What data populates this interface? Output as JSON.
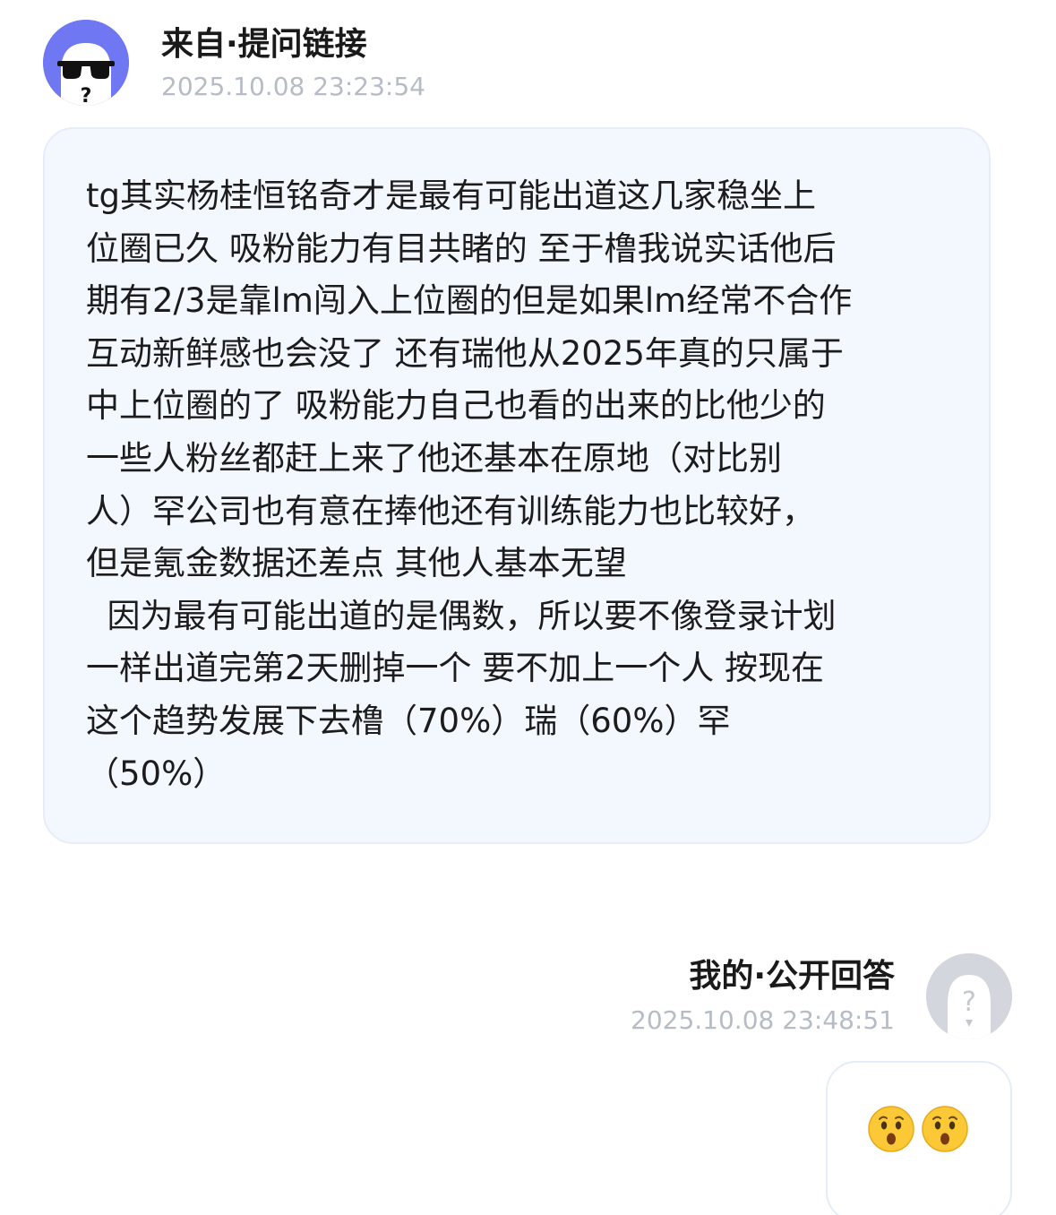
{
  "question": {
    "sender_label": "来自·提问链接",
    "timestamp": "2025.10.08 23:23:54",
    "avatar": "sunglasses-ghost-avatar",
    "lines": [
      "tg其实杨桂恒铭奇才是最有可能出道这几家稳坐上",
      "位圈已久 吸粉能力有目共睹的 至于橹我说实话他后",
      "期有2/3是靠lm闯入上位圈的但是如果lm经常不合作",
      "互动新鲜感也会没了 还有瑞他从2025年真的只属于",
      "中上位圈的了 吸粉能力自己也看的出来的比他少的",
      "一些人粉丝都赶上来了他还基本在原地（对比别",
      "人）罕公司也有意在捧他还有训练能力也比较好，",
      "但是氪金数据还差点 其他人基本无望",
      "  因为最有可能出道的是偶数，所以要不像登录计划",
      "一样出道完第2天删掉一个 要不加上一个人 按现在",
      "这个趋势发展下去橹（70%）瑞（60%）罕",
      "（50%）"
    ],
    "colors": {
      "bubble_bg": "#f3f7fe",
      "avatar_bg": "#6f78f2"
    }
  },
  "answer": {
    "sender_label": "我的·公开回答",
    "timestamp": "2025.10.08 23:48:51",
    "avatar": "default-question-avatar",
    "emojis": [
      "hushed-face",
      "hushed-face"
    ]
  }
}
